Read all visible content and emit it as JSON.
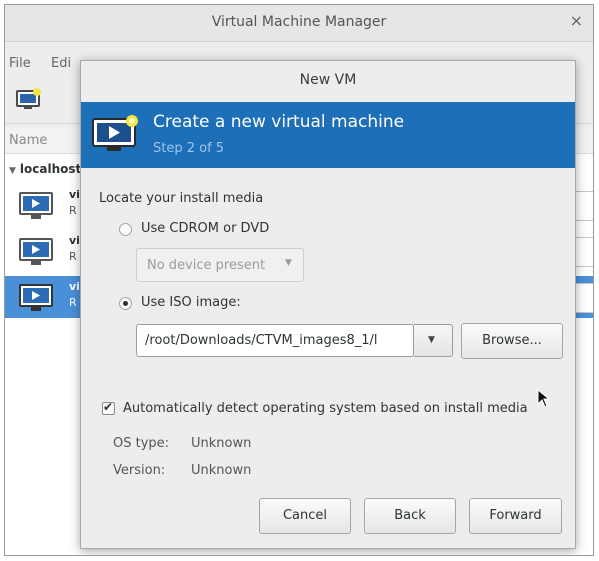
{
  "main_window": {
    "title": "Virtual Machine Manager",
    "close_glyph": "×",
    "menu": {
      "file": "File",
      "edit": "Edi"
    },
    "column_header": "Name",
    "host": "localhost",
    "host_arrow": "▼",
    "vms": [
      {
        "name": "vi",
        "status": "R"
      },
      {
        "name": "vi",
        "status": "R"
      },
      {
        "name": "vi",
        "status": "R"
      }
    ]
  },
  "dialog": {
    "title": "New VM",
    "banner_title": "Create a new virtual machine",
    "banner_step": "Step 2 of 5",
    "locate_label": "Locate your install media",
    "cdrom_option": "Use CDROM or DVD",
    "cdrom_combo_value": "No device present",
    "iso_option": "Use ISO image:",
    "iso_path": "/root/Downloads/CTVM_images8_1/l",
    "browse_button": "Browse...",
    "auto_detect_label": "Automatically detect operating system based on install media",
    "auto_detect_checked": true,
    "os_type_label": "OS type:",
    "os_type_value": "Unknown",
    "version_label": "Version:",
    "version_value": "Unknown",
    "cancel_button": "Cancel",
    "back_button": "Back",
    "forward_button": "Forward",
    "selected_media": "iso"
  },
  "glyphs": {
    "dropdown": "▼",
    "check": "✔"
  },
  "icons": [
    "new-vm-icon",
    "monitor-icon",
    "mouse-pointer-icon"
  ],
  "colors": {
    "banner": "#1d6fb8",
    "selection": "#4a90d9",
    "step_text": "#9cc6ec"
  }
}
